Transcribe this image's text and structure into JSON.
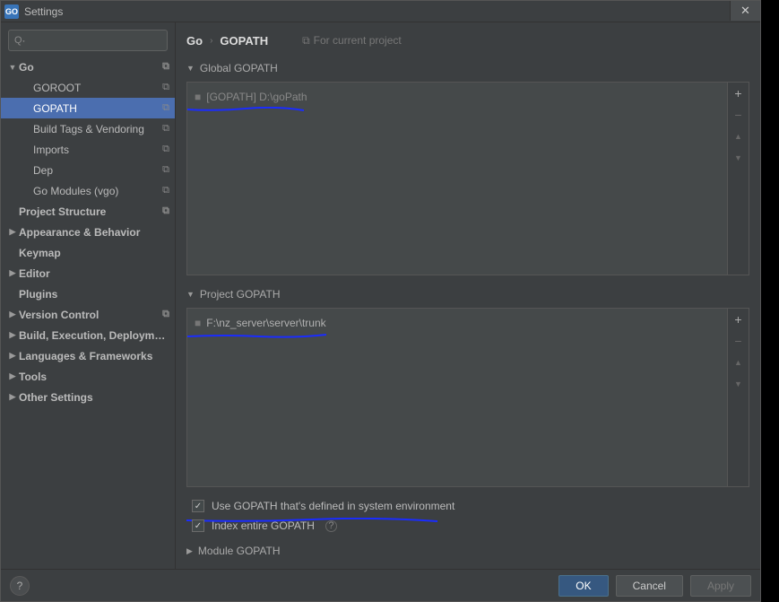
{
  "window": {
    "title": "Settings",
    "app_icon_text": "GO"
  },
  "search": {
    "placeholder": ""
  },
  "sidebar": {
    "items": [
      {
        "label": "Go",
        "bold": true,
        "expanded": true,
        "copy": true,
        "indent": 0
      },
      {
        "label": "GOROOT",
        "copy": true,
        "indent": 1
      },
      {
        "label": "GOPATH",
        "copy": true,
        "indent": 1,
        "selected": true
      },
      {
        "label": "Build Tags & Vendoring",
        "copy": true,
        "indent": 1
      },
      {
        "label": "Imports",
        "copy": true,
        "indent": 1
      },
      {
        "label": "Dep",
        "copy": true,
        "indent": 1
      },
      {
        "label": "Go Modules (vgo)",
        "copy": true,
        "indent": 1
      },
      {
        "label": "Project Structure",
        "bold": true,
        "copy": true,
        "indent": 0
      },
      {
        "label": "Appearance & Behavior",
        "bold": true,
        "expandable": true,
        "indent": 0
      },
      {
        "label": "Keymap",
        "bold": true,
        "indent": 0
      },
      {
        "label": "Editor",
        "bold": true,
        "expandable": true,
        "indent": 0
      },
      {
        "label": "Plugins",
        "bold": true,
        "indent": 0
      },
      {
        "label": "Version Control",
        "bold": true,
        "expandable": true,
        "copy": true,
        "indent": 0
      },
      {
        "label": "Build, Execution, Deployment",
        "bold": true,
        "expandable": true,
        "indent": 0
      },
      {
        "label": "Languages & Frameworks",
        "bold": true,
        "expandable": true,
        "indent": 0
      },
      {
        "label": "Tools",
        "bold": true,
        "expandable": true,
        "indent": 0
      },
      {
        "label": "Other Settings",
        "bold": true,
        "expandable": true,
        "indent": 0
      }
    ]
  },
  "breadcrumb": {
    "root": "Go",
    "leaf": "GOPATH",
    "project_hint": "For current project"
  },
  "sections": {
    "global": {
      "title": "Global GOPATH",
      "entry": "[GOPATH] D:\\goPath"
    },
    "project": {
      "title": "Project GOPATH",
      "entry": "F:\\nz_server\\server\\trunk"
    },
    "module": {
      "title": "Module GOPATH"
    }
  },
  "checkboxes": {
    "use_env": {
      "label": "Use GOPATH that's defined in system environment",
      "checked": true
    },
    "index_all": {
      "label": "Index entire GOPATH",
      "checked": true
    }
  },
  "buttons": {
    "ok": "OK",
    "cancel": "Cancel",
    "apply": "Apply"
  },
  "icons": {
    "add": "+",
    "remove": "−",
    "up": "▲",
    "down": "▼",
    "check": "✓",
    "help": "?",
    "close": "✕",
    "copy": "⧉",
    "folder": "■",
    "search": "Q˖"
  }
}
